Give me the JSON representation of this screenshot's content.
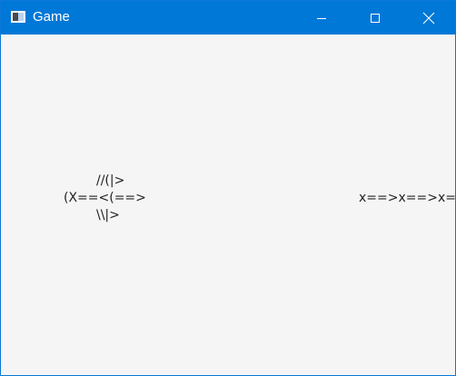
{
  "window": {
    "title": "Game",
    "icon": "window-app-icon",
    "controls": {
      "minimize_icon": "minimize-icon",
      "maximize_icon": "maximize-icon",
      "close_icon": "close-icon"
    },
    "accent_color": "#0078d7"
  },
  "game": {
    "ship": {
      "line1": "//(|>",
      "line2": "(X==<(==>",
      "line3": "\\\\|>"
    },
    "bullets": "x==>x==>x==>"
  }
}
